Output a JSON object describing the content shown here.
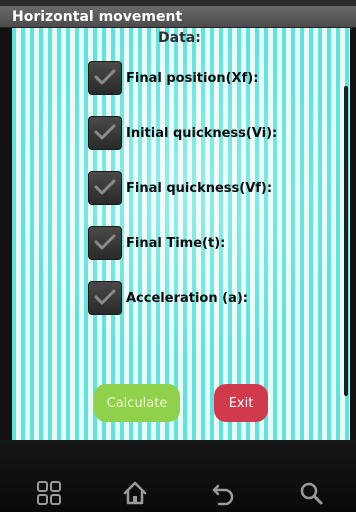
{
  "window": {
    "title": "Horizontal movement"
  },
  "form": {
    "heading": "Data:",
    "options": [
      {
        "label": "Final position(Xf):",
        "checked": true
      },
      {
        "label": "Initial quickness(Vi):",
        "checked": true
      },
      {
        "label": "Final quickness(Vf):",
        "checked": true
      },
      {
        "label": "Final Time(t):",
        "checked": true
      },
      {
        "label": "Acceleration (a):",
        "checked": true
      }
    ]
  },
  "buttons": {
    "calculate_label": "Calculate",
    "exit_label": "Exit"
  },
  "colors": {
    "accent_green": "#8fd14a",
    "accent_red": "#d13a4a",
    "background_cyan": "#5fe3dc"
  },
  "nav": {
    "icons": [
      "apps-icon",
      "home-icon",
      "back-icon",
      "search-icon"
    ]
  }
}
